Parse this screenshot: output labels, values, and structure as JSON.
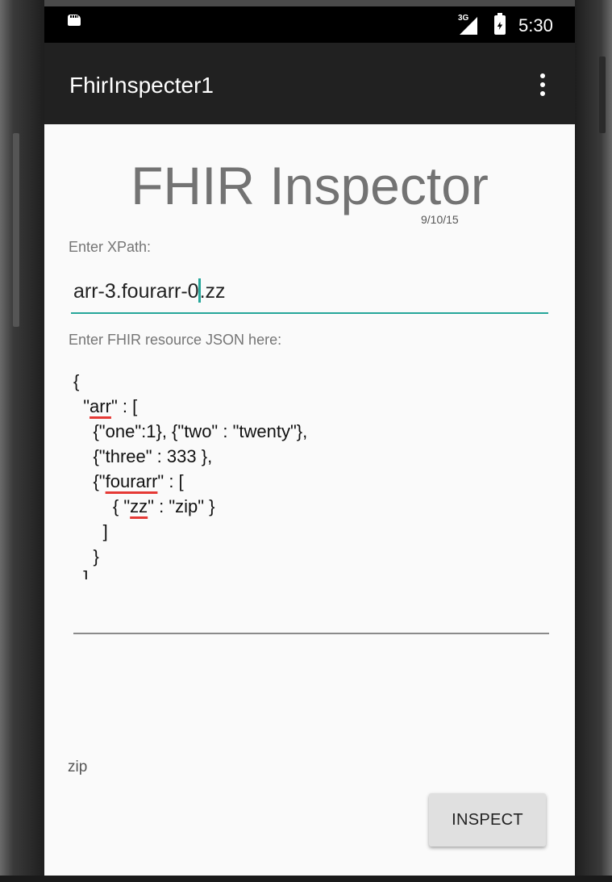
{
  "status_bar": {
    "signal_label": "3G",
    "time": "5:30",
    "icons": [
      "sd-card-icon",
      "signal-icon",
      "battery-charging-icon"
    ]
  },
  "app_bar": {
    "title": "FhirInspecter1",
    "menu_icon": "overflow-menu-icon"
  },
  "main": {
    "heading": "FHIR Inspector",
    "date": "9/10/15",
    "xpath_label": "Enter XPath:",
    "xpath_value_before_caret": "arr-3.fourarr-0",
    "xpath_value_after_caret": ".zz",
    "json_label": "Enter FHIR resource JSON here:",
    "json_lines": [
      [
        "{",
        "",
        ""
      ],
      [
        "  \"",
        "arr",
        "\" : ["
      ],
      [
        "    {\"one\":1}, {\"two\" : \"twenty\"},",
        "",
        ""
      ],
      [
        "    {\"three\" : 333 },",
        "",
        ""
      ],
      [
        "    {\"",
        "fourarr",
        "\" : ["
      ],
      [
        "        { \"",
        "zz",
        "\" : \"zip\" }"
      ],
      [
        "      ]",
        "",
        ""
      ],
      [
        "    }",
        "",
        ""
      ],
      [
        "  ]",
        "",
        ""
      ]
    ],
    "result": "zip",
    "inspect_button": "INSPECT"
  },
  "colors": {
    "accent": "#26a69a",
    "app_bar": "#212121",
    "status_bar": "#000000",
    "spellcheck": "#e53935"
  }
}
